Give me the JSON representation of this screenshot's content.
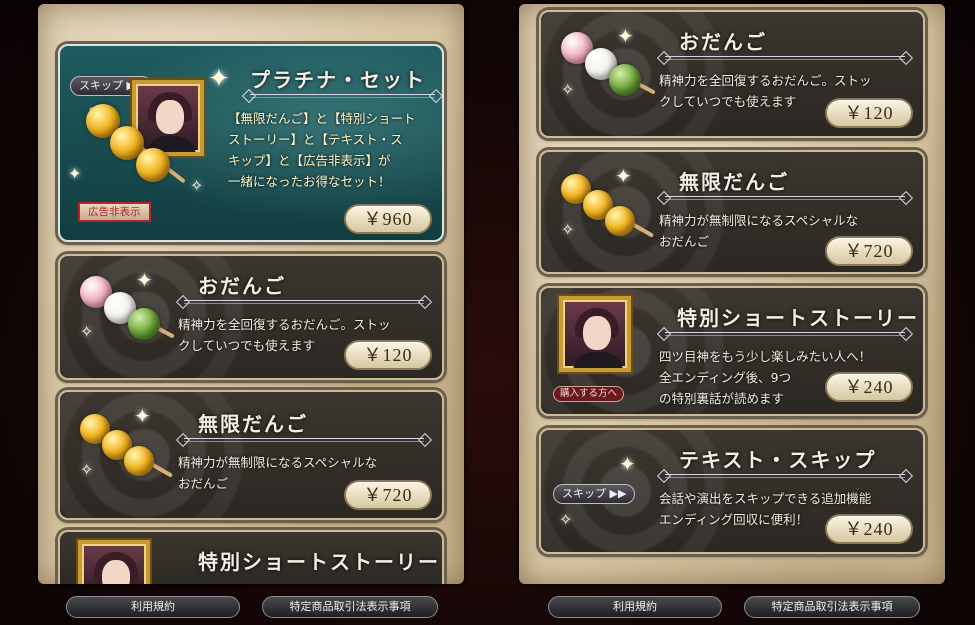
{
  "left_panel": {
    "platinum": {
      "title": "プラチナ・セット",
      "desc": "【無限だんご】と【特別ショート\nストーリー】と【テキスト・ス\nキップ】と【広告非表示】が\n一緒になったお得なセット！",
      "price": "￥960",
      "skip_label": "スキップ ▶▶",
      "ad_badge": "広告非表示"
    },
    "odango": {
      "title": "おだんご",
      "desc": "精神力を全回復するおだんご。ストッ\nクしていつでも使えます",
      "price": "￥120"
    },
    "mugen": {
      "title": "無限だんご",
      "desc": "精神力が無制限になるスペシャルな\nおだんご",
      "price": "￥720"
    },
    "partial": {
      "title": "特別ショートストーリー"
    }
  },
  "right_panel": {
    "odango": {
      "title": "おだんご",
      "desc": "精神力を全回復するおだんご。ストッ\nクしていつでも使えます",
      "price": "￥120"
    },
    "mugen": {
      "title": "無限だんご",
      "desc": "精神力が無制限になるスペシャルな\nおだんご",
      "price": "￥720"
    },
    "story": {
      "title": "特別ショートストーリー",
      "desc": "四ツ目神をもう少し楽しみたい人へ！\n全エンディング後、9つ\nの特別裏話が読めます",
      "price": "￥240",
      "badge": "購入する方へ"
    },
    "skip": {
      "title": "テキスト・スキップ",
      "desc": "会話や演出をスキップできる追加機能\nエンディング回収に便利！",
      "price": "￥240",
      "skip_label": "スキップ ▶▶"
    }
  },
  "footer": {
    "terms": "利用規約",
    "commerce": "特定商品取引法表示事項"
  },
  "colors": {
    "platinum_bg": "#1f5b5e",
    "card_bg": "#2b2722",
    "parchment": "#d8c7a3",
    "price_text": "#3a2d18"
  }
}
